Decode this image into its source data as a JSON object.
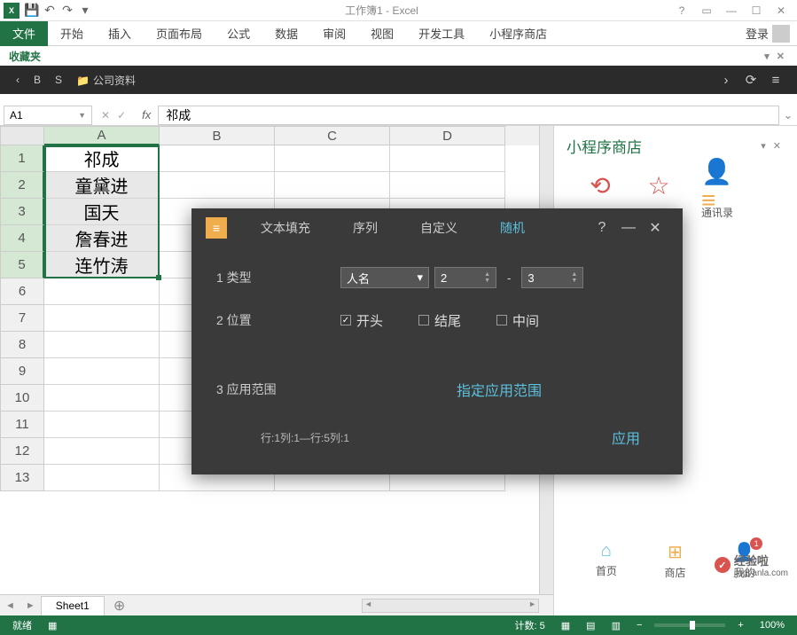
{
  "title": "工作簿1 - Excel",
  "ribbon": {
    "file": "文件",
    "tabs": [
      "开始",
      "插入",
      "页面布局",
      "公式",
      "数据",
      "审阅",
      "视图",
      "开发工具",
      "小程序商店"
    ],
    "login": "登录"
  },
  "favbar": {
    "label": "收藏夹"
  },
  "darkbar": {
    "b": "B",
    "s": "S",
    "folder": "公司资料"
  },
  "namebox": "A1",
  "formula": "祁成",
  "columns": [
    "A",
    "B",
    "C",
    "D"
  ],
  "rows_count": 13,
  "cells": {
    "A1": "祁成",
    "A2": "童黛进",
    "A3": "国天",
    "A4": "詹春进",
    "A5": "连竹涛"
  },
  "sheet_tab": "Sheet1",
  "sidepanel": {
    "title": "小程序商店",
    "contacts": "通讯录",
    "home": "首页",
    "store": "商店",
    "mine": "我的"
  },
  "watermark": {
    "text1": "经验啦",
    "text2": "jingyanla.com"
  },
  "statusbar": {
    "ready": "就绪",
    "count": "计数: 5",
    "zoom": "100%"
  },
  "dialog": {
    "tabs": {
      "fill": "文本填充",
      "seq": "序列",
      "custom": "自定义",
      "random": "随机"
    },
    "row1_label": "1 类型",
    "type_select": "人名",
    "num_from": "2",
    "num_to": "3",
    "row2_label": "2 位置",
    "pos_start": "开头",
    "pos_end": "结尾",
    "pos_mid": "中间",
    "row3_label": "3 应用范围",
    "range_link": "指定应用范围",
    "range_text": "行:1列:1—行:5列:1",
    "apply": "应用"
  }
}
